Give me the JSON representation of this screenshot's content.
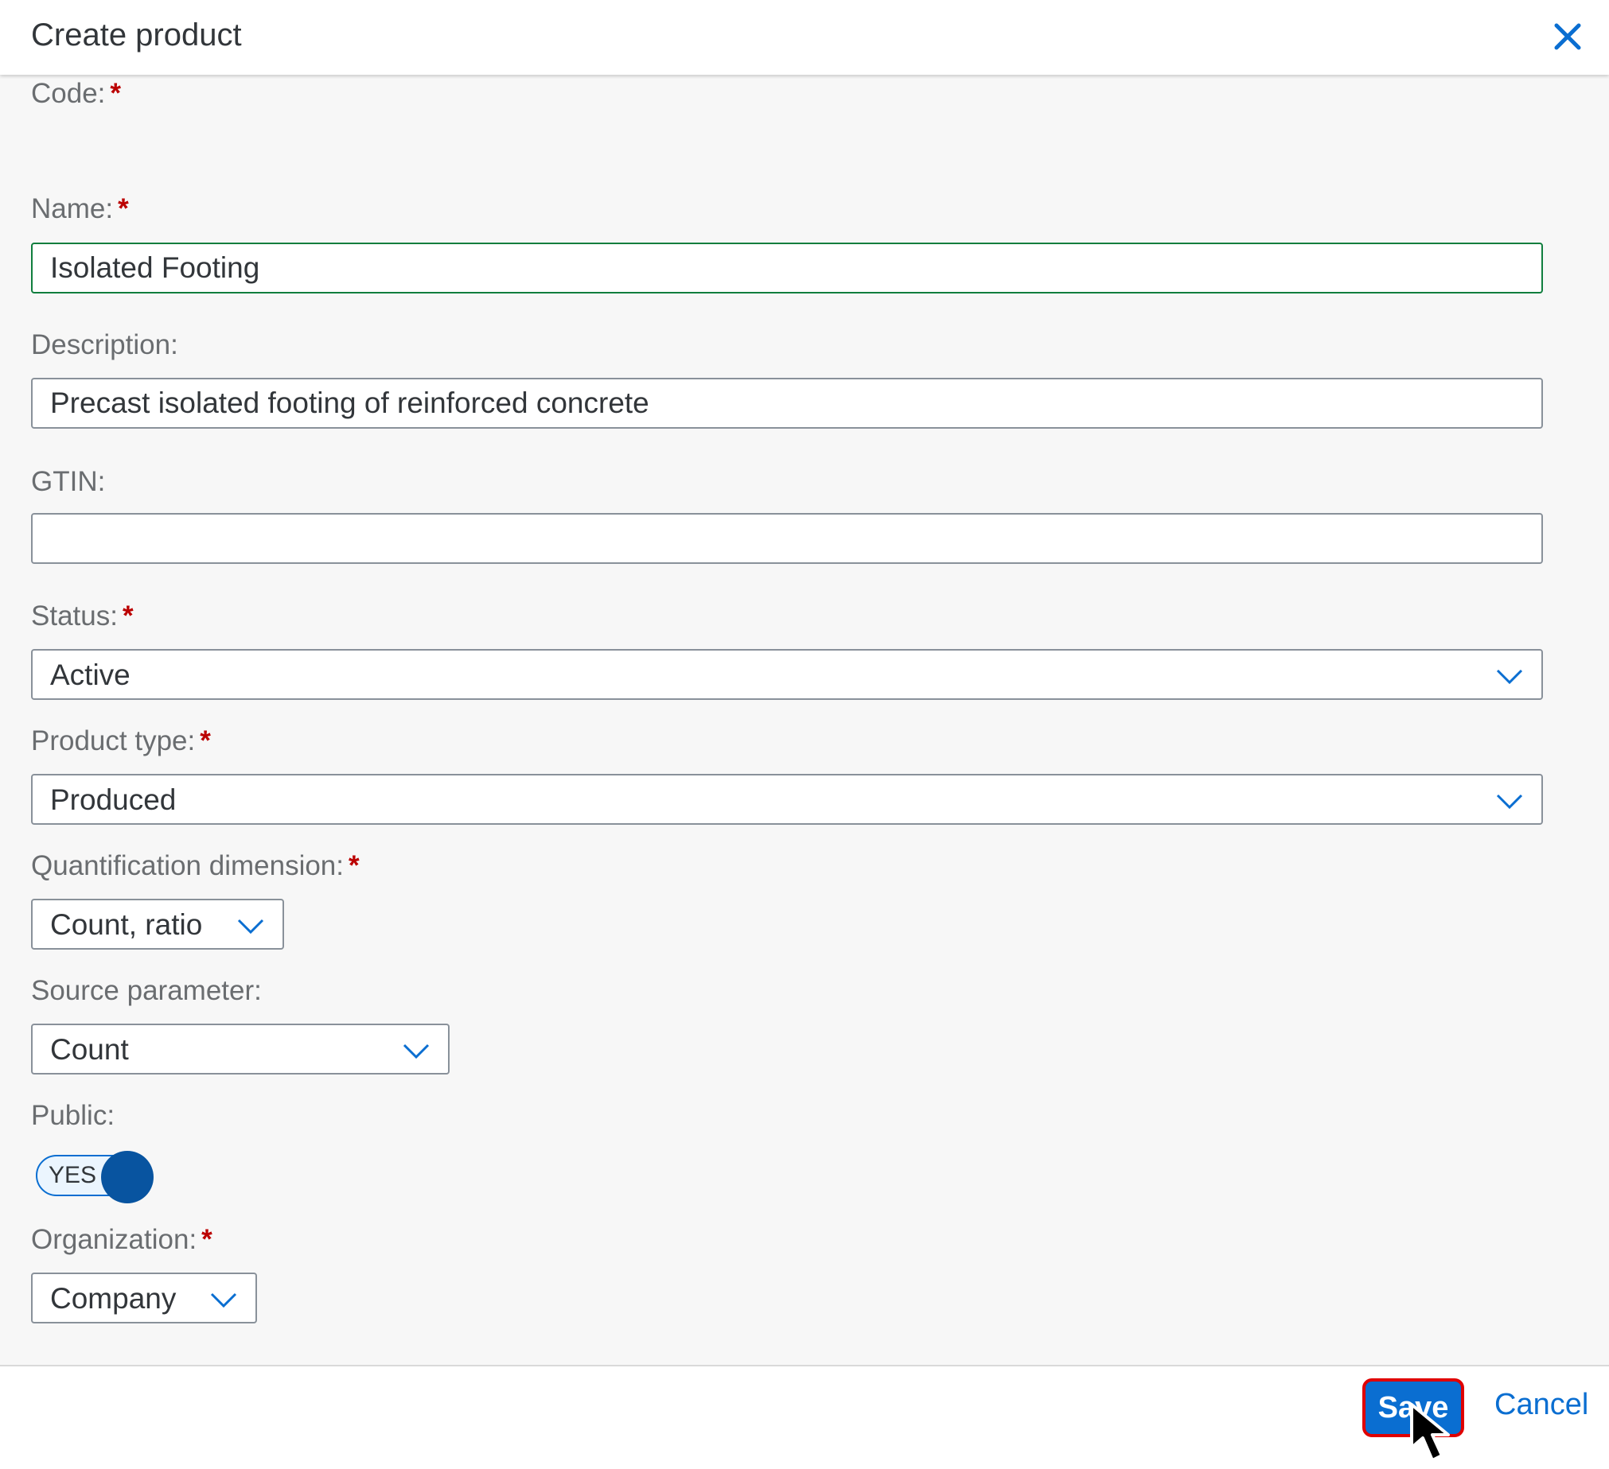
{
  "dialog": {
    "title": "Create product"
  },
  "form": {
    "code": {
      "label": "Code:",
      "required_mark": "*"
    },
    "name": {
      "label": "Name:",
      "required_mark": "*",
      "value": "Isolated Footing"
    },
    "description": {
      "label": "Description:",
      "value": "Precast isolated footing of reinforced concrete"
    },
    "gtin": {
      "label": "GTIN:",
      "value": ""
    },
    "status": {
      "label": "Status:",
      "required_mark": "*",
      "value": "Active"
    },
    "product_type": {
      "label": "Product type:",
      "required_mark": "*",
      "value": "Produced"
    },
    "quantification_dimension": {
      "label": "Quantification dimension:",
      "required_mark": "*",
      "value": "Count, ratio"
    },
    "source_parameter": {
      "label": "Source parameter:",
      "value": "Count"
    },
    "public": {
      "label": "Public:",
      "toggle_text": "YES",
      "on": true
    },
    "organization": {
      "label": "Organization:",
      "required_mark": "*",
      "value": "Company"
    }
  },
  "footer": {
    "save_label": "Save",
    "cancel_label": "Cancel"
  },
  "colors": {
    "accent": "#0a6ed1",
    "required": "#bb0000",
    "focus_border": "#107e3e",
    "highlight": "#e00000"
  },
  "icons": {
    "close": "close-icon",
    "dropdown": "chevron-down-icon",
    "cursor": "mouse-pointer-icon"
  }
}
